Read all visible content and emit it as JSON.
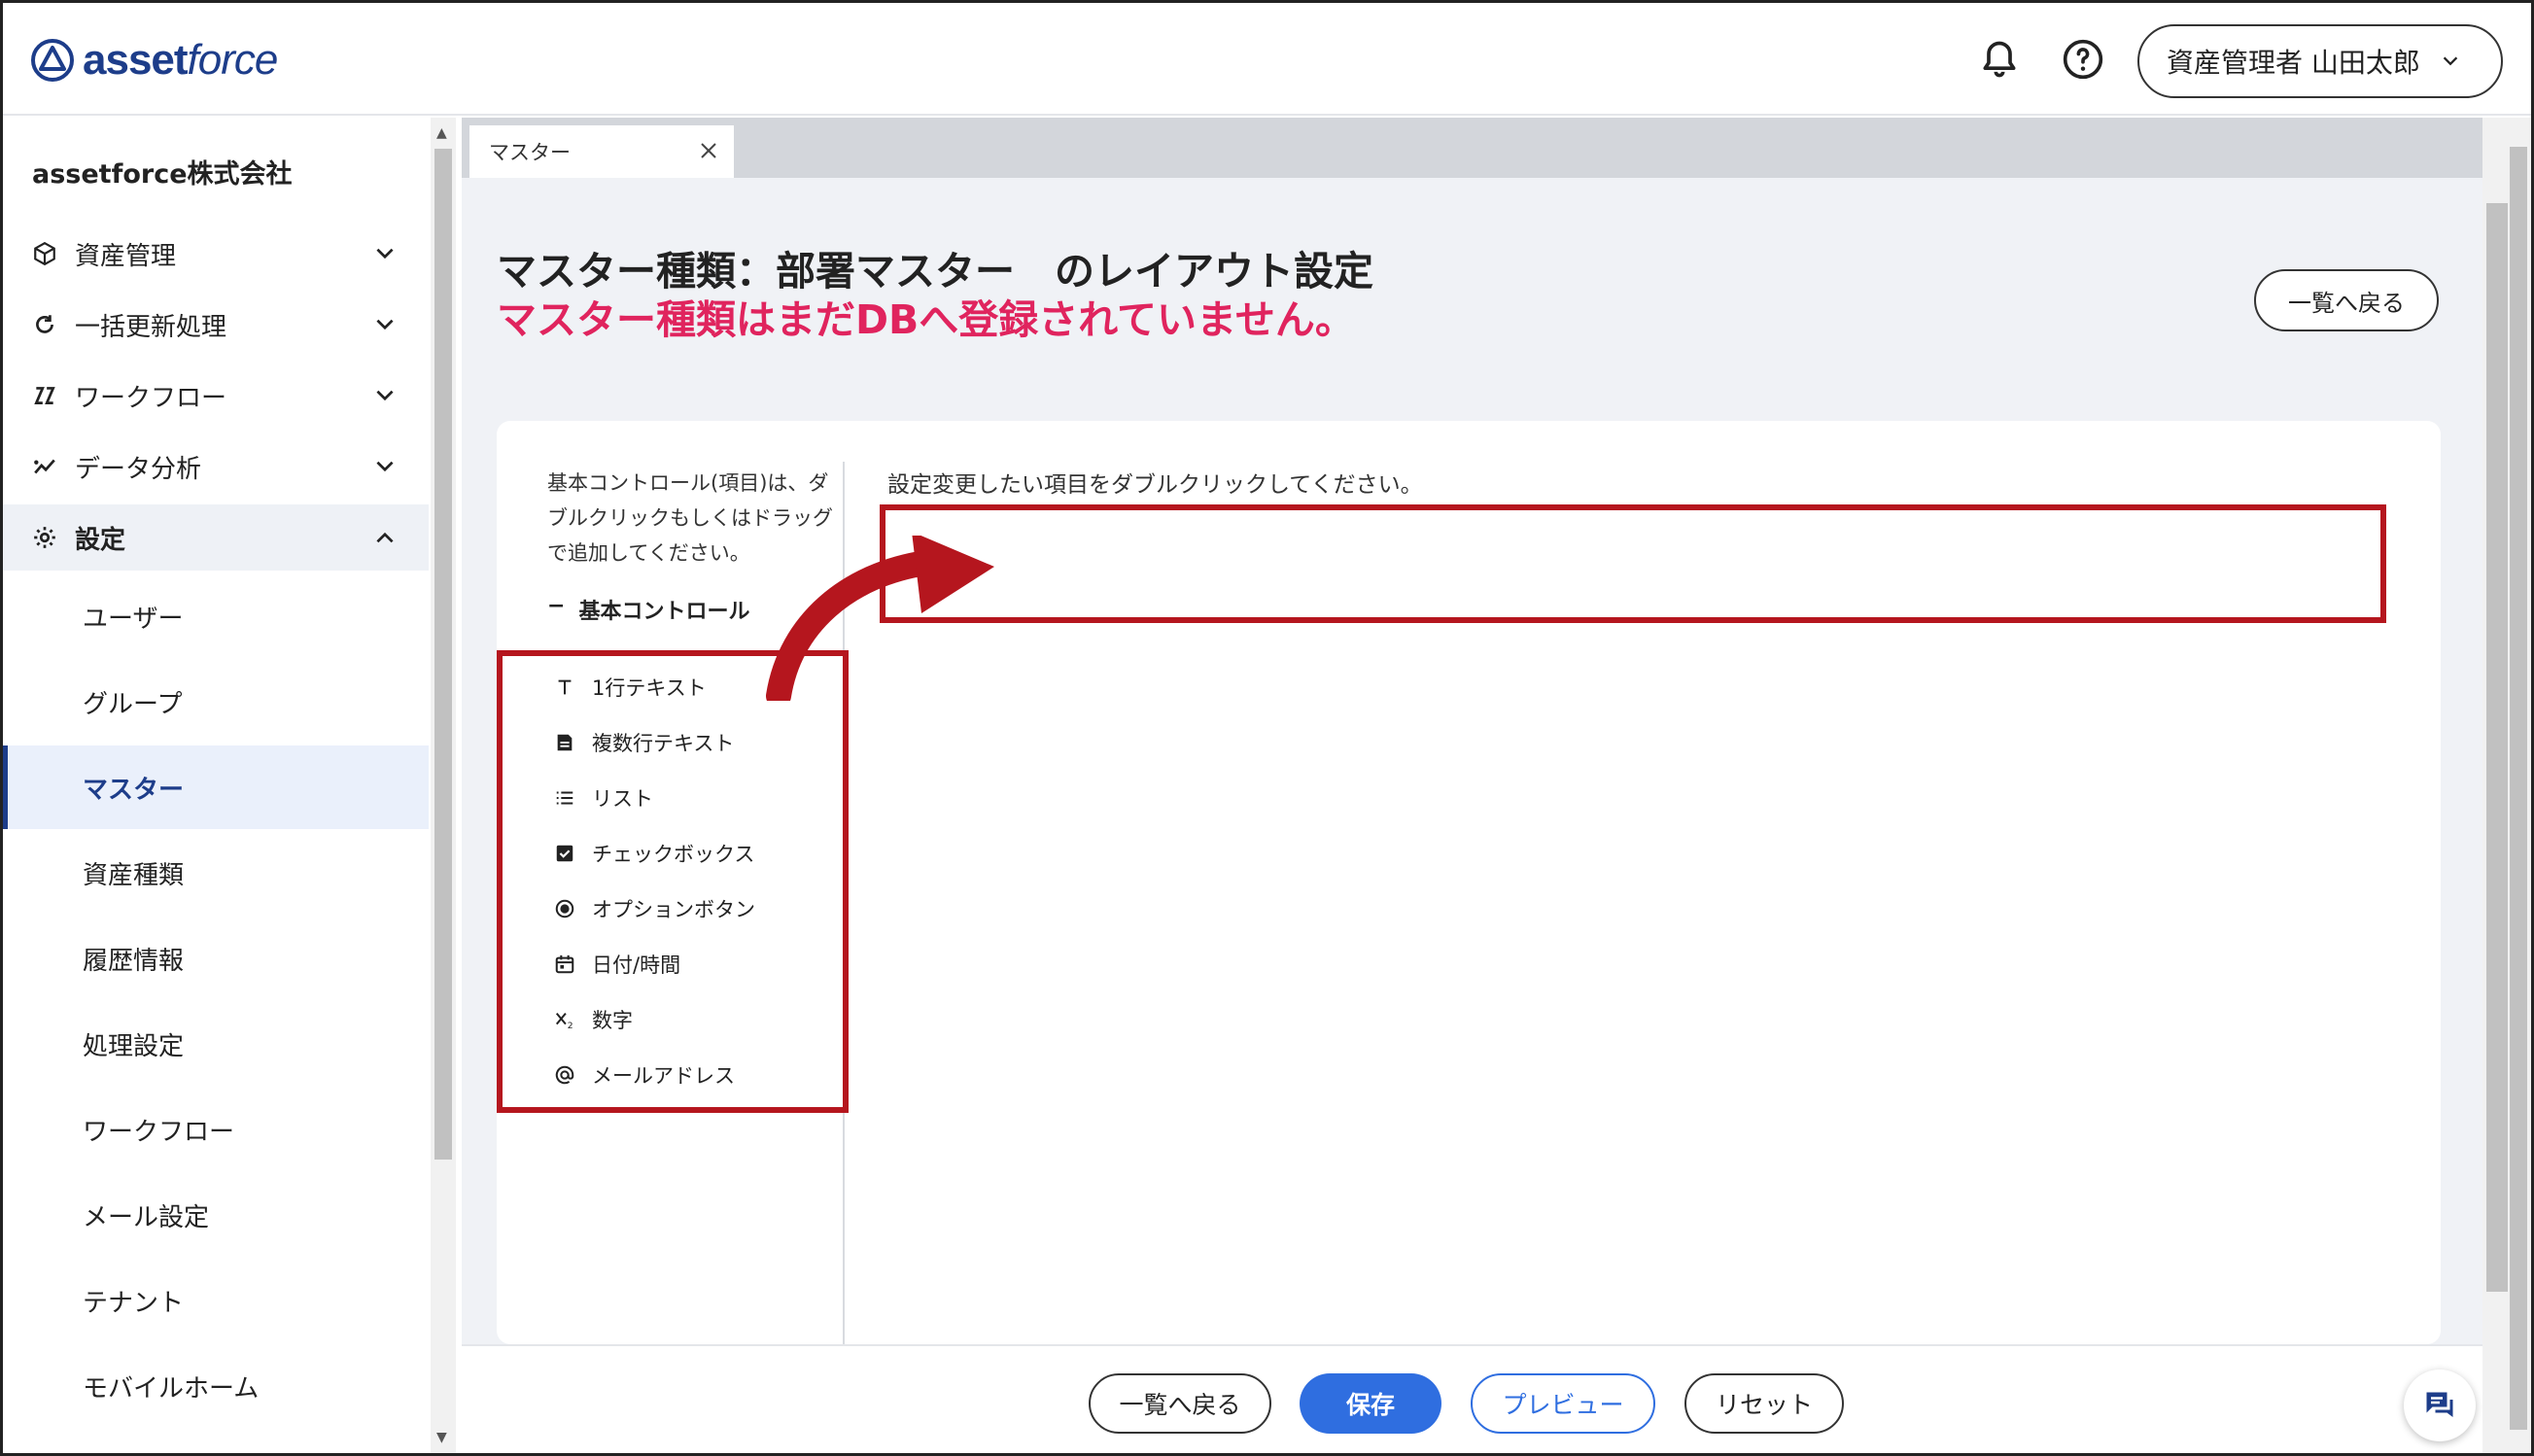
{
  "header": {
    "brand_bold": "asset",
    "brand_italic": "force",
    "user_label": "資産管理者 山田太郎"
  },
  "sidebar": {
    "company": "assetforce株式会社",
    "groups": [
      {
        "label": "資産管理",
        "icon": "cube-icon"
      },
      {
        "label": "一括更新処理",
        "icon": "refresh-icon"
      },
      {
        "label": "ワークフロー",
        "icon": "workflow-icon"
      },
      {
        "label": "データ分析",
        "icon": "chart-icon"
      },
      {
        "label": "設定",
        "icon": "gear-icon"
      }
    ],
    "sub_items": [
      "ユーザー",
      "グループ",
      "マスター",
      "資産種類",
      "履歴情報",
      "処理設定",
      "ワークフロー",
      "メール設定",
      "テナント",
      "モバイルホーム"
    ]
  },
  "tab": {
    "label": "マスター"
  },
  "page": {
    "title": "マスター種類：部署マスター　のレイアウト設定",
    "warning": "マスター種類はまだDBへ登録されていません。",
    "back_label": "一覧へ戻る"
  },
  "palette": {
    "hint": "基本コントロール(項目)は、ダブルクリックもしくはドラッグで追加してください。",
    "section": "基本コントロール",
    "controls": [
      {
        "label": "1行テキスト",
        "icon": "text-icon"
      },
      {
        "label": "複数行テキスト",
        "icon": "multiline-icon"
      },
      {
        "label": "リスト",
        "icon": "list-icon"
      },
      {
        "label": "チェックボックス",
        "icon": "checkbox-icon"
      },
      {
        "label": "オプションボタン",
        "icon": "radio-icon"
      },
      {
        "label": "日付/時間",
        "icon": "calendar-icon"
      },
      {
        "label": "数字",
        "icon": "number-icon"
      },
      {
        "label": "メールアドレス",
        "icon": "at-icon"
      }
    ]
  },
  "canvas": {
    "hint": "設定変更したい項目をダブルクリックしてください。"
  },
  "footer": {
    "back": "一覧へ戻る",
    "save": "保存",
    "preview": "プレビュー",
    "reset": "リセット"
  },
  "colors": {
    "brand": "#1d3d8a",
    "warning": "#e0245e",
    "primary": "#2f6ee0",
    "annotation": "#b5161e"
  }
}
